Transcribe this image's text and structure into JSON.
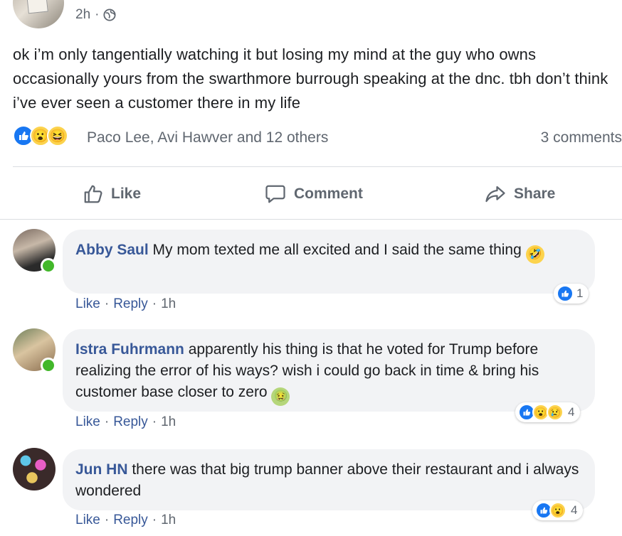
{
  "post": {
    "time": "2h",
    "time_sep": "·",
    "privacy_icon": "globe-icon",
    "text": "ok i’m only tangentially watching it but losing my mind at the guy who owns occasionally yours from the swarthmore burrough speaking at the dnc. tbh don’t think i’ve ever seen a customer there in my life",
    "reactions": {
      "types": [
        "like",
        "wow",
        "haha"
      ],
      "names": "Paco Lee, Avi Hawver and 12 others",
      "comments_count": "3 comments"
    }
  },
  "actions": {
    "like": "Like",
    "comment": "Comment",
    "share": "Share"
  },
  "comments": [
    {
      "author": "Abby Saul",
      "text": "My mom texted me all excited and I said the same thing",
      "emoji": "🤣",
      "like": "Like",
      "reply": "Reply",
      "time": "1h",
      "reaction_count": "1",
      "reaction_types": [
        "like"
      ]
    },
    {
      "author": "Istra Fuhrmann",
      "text": "apparently his thing is that he voted for Trump before realizing the error of his ways? wish i could go back in time & bring his customer base closer to zero",
      "emoji": "🤢",
      "like": "Like",
      "reply": "Reply",
      "time": "1h",
      "reaction_count": "4",
      "reaction_types": [
        "like",
        "wow",
        "sad"
      ]
    },
    {
      "author": "Jun HN",
      "text": "there was that big trump banner above their restaurant and i always wondered",
      "emoji": "",
      "like": "Like",
      "reply": "Reply",
      "time": "1h",
      "reaction_count": "4",
      "reaction_types": [
        "like",
        "wow"
      ]
    }
  ],
  "colors": {
    "author": "#385898",
    "online": "#42b72a",
    "like_blue": "#1877f2",
    "bubble_bg": "#f2f3f5"
  }
}
